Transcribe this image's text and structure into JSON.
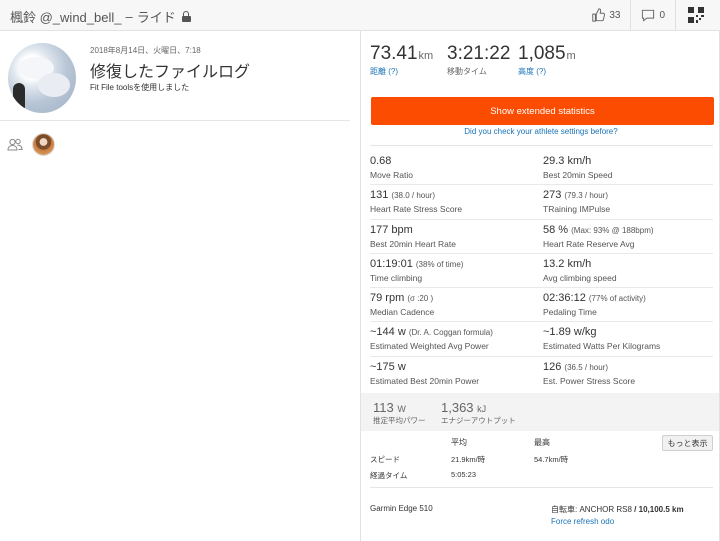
{
  "header": {
    "athlete": "楓鈴 @_wind_bell_",
    "separator": "–",
    "activity_type": "ライド",
    "kudos_count": "33",
    "comment_count": "0"
  },
  "activity": {
    "date": "2018年8月14日、火曜日、7:18",
    "title": "修復したファイルログ",
    "description": "Fit File toolsを使用しました"
  },
  "summary": {
    "distance": {
      "value": "73.41",
      "unit": "km",
      "label": "距離",
      "help": "(?)"
    },
    "moving_time": {
      "value": "3:21:22",
      "label": "移動タイム"
    },
    "elevation": {
      "value": "1,085",
      "unit": "m",
      "label": "高度",
      "help": "(?)"
    }
  },
  "extended_button": "Show extended statistics",
  "settings_link": "Did you check your athlete settings before?",
  "stats": [
    {
      "l": {
        "v": "0.68",
        "x": "",
        "d": "Move Ratio"
      },
      "r": {
        "v": "29.3 km/h",
        "x": "",
        "d": "Best 20min Speed"
      }
    },
    {
      "l": {
        "v": "131",
        "x": "(38.0 / hour)",
        "d": "Heart Rate Stress Score"
      },
      "r": {
        "v": "273",
        "x": "(79.3 / hour)",
        "d": "TRaining IMPulse"
      }
    },
    {
      "l": {
        "v": "177 bpm",
        "x": "",
        "d": "Best 20min Heart Rate"
      },
      "r": {
        "v": "58 %",
        "x": "(Max: 93% @ 188bpm)",
        "d": "Heart Rate Reserve Avg"
      }
    },
    {
      "l": {
        "v": "01:19:01",
        "x": "(38% of time)",
        "d": "Time climbing"
      },
      "r": {
        "v": "13.2 km/h",
        "x": "",
        "d": "Avg climbing speed"
      }
    },
    {
      "l": {
        "v": "79 rpm",
        "x": "(σ :20 )",
        "d": "Median Cadence"
      },
      "r": {
        "v": "02:36:12",
        "x": "(77% of activity)",
        "d": "Pedaling Time"
      }
    },
    {
      "l": {
        "v": "~144 w",
        "x": "(Dr. A. Coggan formula)",
        "d": "Estimated Weighted Avg Power"
      },
      "r": {
        "v": "~1.89 w/kg",
        "x": "",
        "d": "Estimated Watts Per Kilograms"
      }
    },
    {
      "l": {
        "v": "~175 w",
        "x": "",
        "d": "Estimated Best 20min Power"
      },
      "r": {
        "v": "126",
        "x": "(36.5 / hour)",
        "d": "Est. Power Stress Score"
      }
    }
  ],
  "power": {
    "avg": {
      "value": "113",
      "unit": "W",
      "label": "推定平均パワー"
    },
    "energy": {
      "value": "1,363",
      "unit": "kJ",
      "label": "エナジーアウトプット"
    }
  },
  "table": {
    "col_avg": "平均",
    "col_max": "最高",
    "more_button": "もっと表示",
    "rows": [
      {
        "label": "スピード",
        "avg": "21.9km/時",
        "max": "54.7km/時"
      },
      {
        "label": "経過タイム",
        "avg": "5:05:23",
        "max": ""
      }
    ]
  },
  "device": "Garmin Edge 510",
  "bike": {
    "label": "自転車:",
    "name": "ANCHOR RS8",
    "slash": "/",
    "odo": "10,100.5 km"
  },
  "refresh_link": "Force refresh odo"
}
